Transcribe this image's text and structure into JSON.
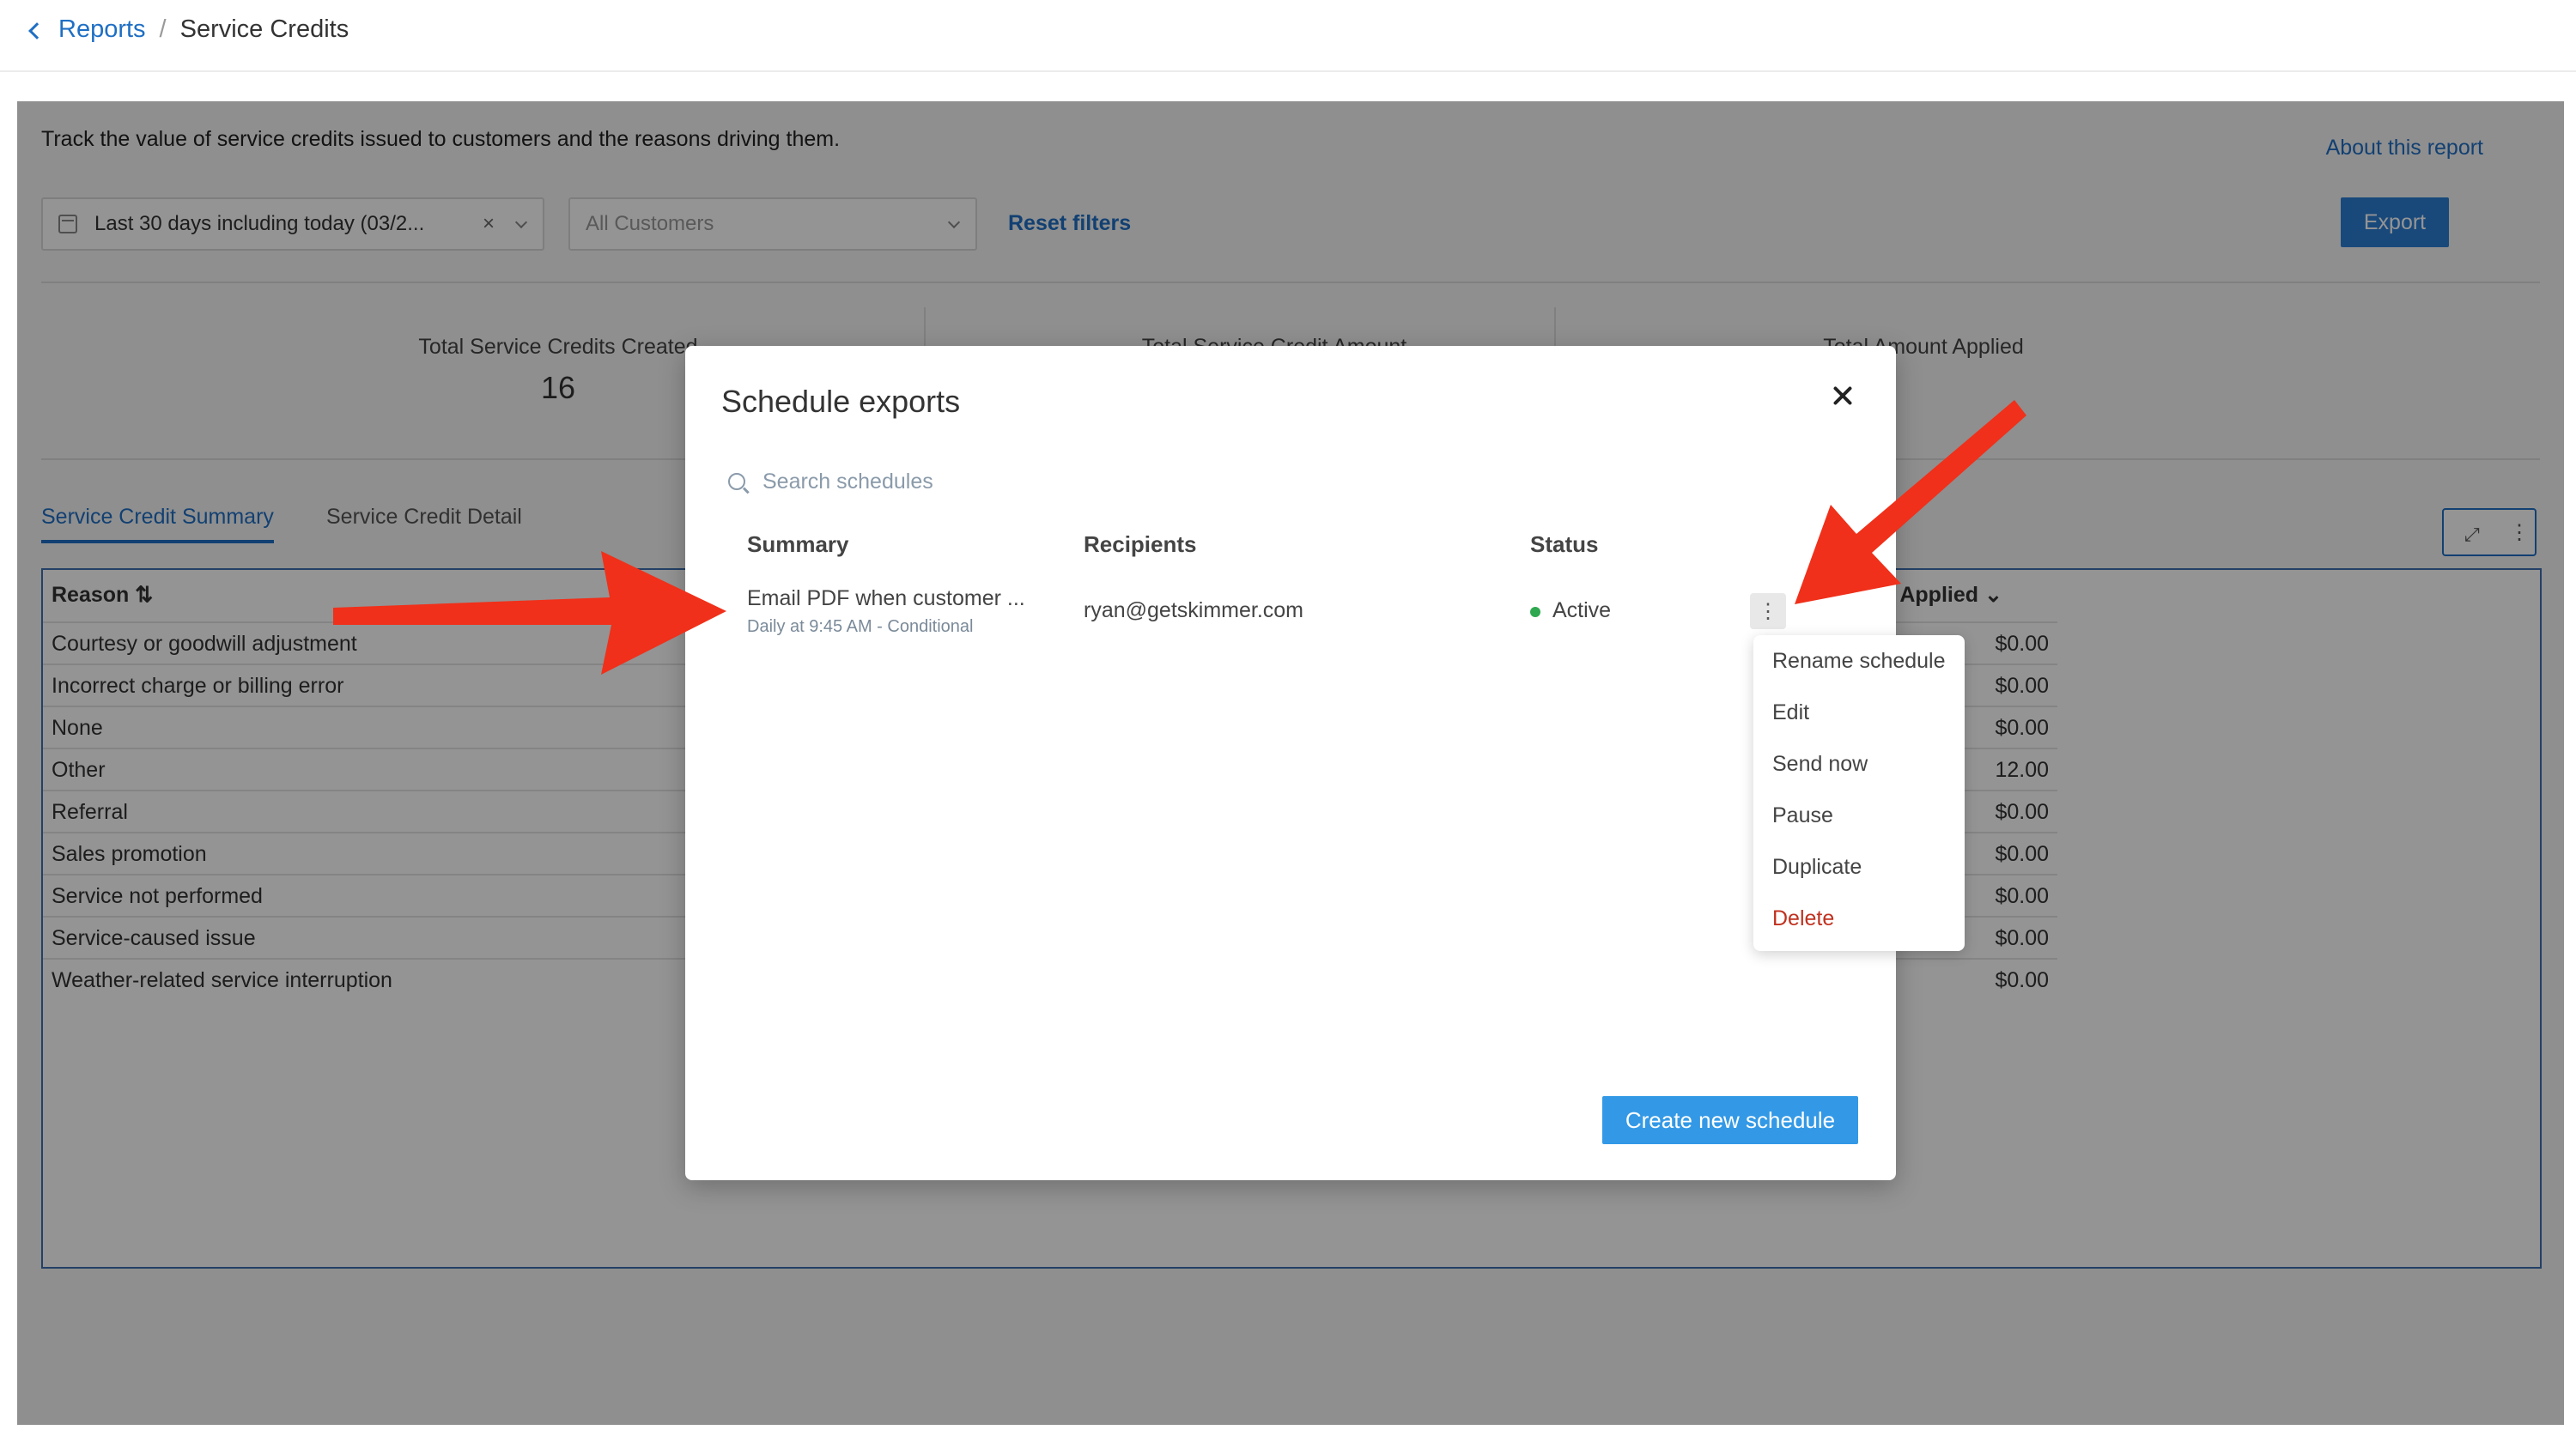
{
  "breadcrumb": {
    "parent": "Reports",
    "separator": "/",
    "current": "Service Credits"
  },
  "report": {
    "description": "Track the value of service credits issued to customers and the reasons driving them.",
    "about_link": "About this report",
    "filters": {
      "date_value": "Last 30 days including today (03/2...",
      "clear_symbol": "×",
      "customer_placeholder": "All Customers",
      "reset_label": "Reset filters"
    },
    "export_label": "Export",
    "metrics": [
      {
        "label": "Total Service Credits Created",
        "value": "16"
      },
      {
        "label": "Total Service Credit Amount",
        "value": ""
      },
      {
        "label": "Total Amount Applied",
        "value": ""
      }
    ],
    "tabs": [
      "Service Credit Summary",
      "Service Credit Detail"
    ],
    "table": {
      "columns": {
        "reason": "Reason",
        "applied": "t Applied"
      },
      "rows": [
        {
          "reason": "Courtesy or goodwill adjustment",
          "applied": "$0.00"
        },
        {
          "reason": "Incorrect charge or billing error",
          "applied": "$0.00"
        },
        {
          "reason": "None",
          "applied": "$0.00"
        },
        {
          "reason": "Other",
          "applied": "12.00"
        },
        {
          "reason": "Referral",
          "applied": "$0.00"
        },
        {
          "reason": "Sales promotion",
          "applied": "$0.00"
        },
        {
          "reason": "Service not performed",
          "applied": "$0.00"
        },
        {
          "reason": "Service-caused issue",
          "applied": "$0.00"
        },
        {
          "reason": "Weather-related service interruption",
          "applied": "$0.00"
        }
      ]
    }
  },
  "modal": {
    "title": "Schedule exports",
    "search_placeholder": "Search schedules",
    "columns": {
      "summary": "Summary",
      "recipients": "Recipients",
      "status": "Status"
    },
    "schedule": {
      "summary": "Email PDF when customer ...",
      "subtitle": "Daily at 9:45 AM - Conditional",
      "recipient": "ryan@getskimmer.com",
      "status": "Active"
    },
    "kebab_symbol": "⋮",
    "create_label": "Create new schedule"
  },
  "menu": {
    "items": [
      "Rename schedule",
      "Edit",
      "Send now",
      "Pause",
      "Duplicate",
      "Delete"
    ]
  },
  "colors": {
    "accent": "#1f6fc4",
    "primary_button": "#3399e6",
    "active_status": "#2fa84f",
    "danger": "#c0311f",
    "annotation_arrow": "#f0301a"
  }
}
